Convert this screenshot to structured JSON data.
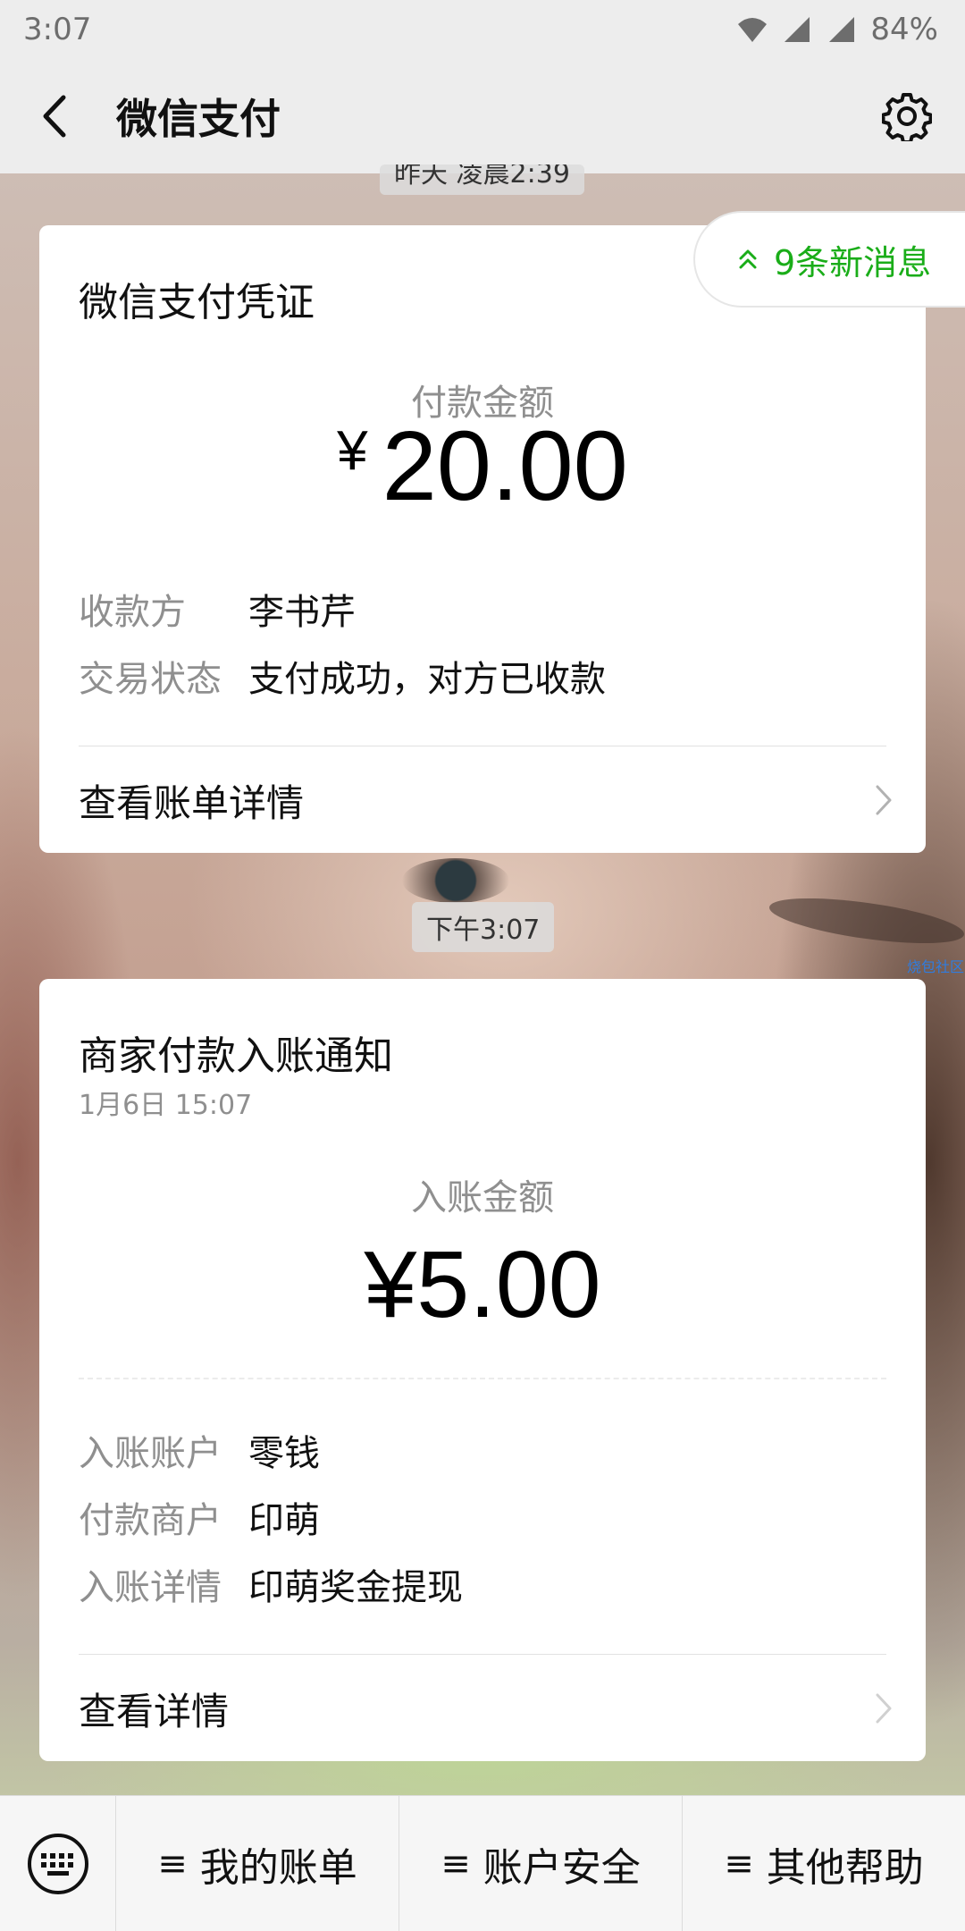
{
  "status_bar": {
    "time": "3:07",
    "battery": "84%"
  },
  "nav": {
    "title": "微信支付"
  },
  "timestamps": {
    "top": "昨天 凌晨2:39",
    "middle": "下午3:07"
  },
  "new_messages": {
    "label": "9条新消息"
  },
  "payment_card": {
    "title": "微信支付凭证",
    "amount_label": "付款金额",
    "currency": "¥",
    "amount": "20.00",
    "fields": [
      {
        "key": "收款方",
        "value": "李书芹"
      },
      {
        "key": "交易状态",
        "value": "支付成功，对方已收款"
      }
    ],
    "link": "查看账单详情"
  },
  "income_card": {
    "title": "商家付款入账通知",
    "date": "1月6日  15:07",
    "amount_label": "入账金额",
    "amount": "¥5.00",
    "fields": [
      {
        "key": "入账账户",
        "value": "零钱"
      },
      {
        "key": "付款商户",
        "value": "印萌"
      },
      {
        "key": "入账详情",
        "value": "印萌奖金提现"
      }
    ],
    "link": "查看详情"
  },
  "watermark": "烧包社区",
  "bottom_menu": [
    {
      "label": "我的账单"
    },
    {
      "label": "账户安全"
    },
    {
      "label": "其他帮助"
    }
  ],
  "colors": {
    "accent_green": "#1aad19",
    "bar_bg": "#ededed"
  }
}
